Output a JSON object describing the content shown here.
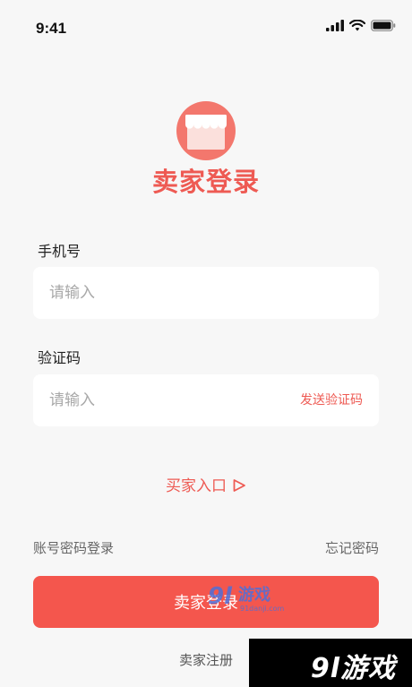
{
  "status_bar": {
    "time": "9:41"
  },
  "header": {
    "title": "卖家登录",
    "logo_icon": "shop-awning-icon"
  },
  "form": {
    "phone": {
      "label": "手机号",
      "value": "",
      "placeholder": "请输入"
    },
    "code": {
      "label": "验证码",
      "value": "",
      "placeholder": "请输入",
      "send_label": "发送验证码"
    }
  },
  "buyer_entry": {
    "label": "买家入口",
    "icon": "play-triangle-outline-icon"
  },
  "links": {
    "account_login": "账号密码登录",
    "forgot_password": "忘记密码",
    "register": "卖家注册"
  },
  "login_button": {
    "label": "卖家登录"
  },
  "watermark": {
    "center_text": "游戏",
    "center_sub": "91danji.com",
    "corner_text": "9l游戏"
  },
  "colors": {
    "accent": "#ee5a53",
    "button": "#f4564d",
    "background": "#f7f7f7"
  }
}
